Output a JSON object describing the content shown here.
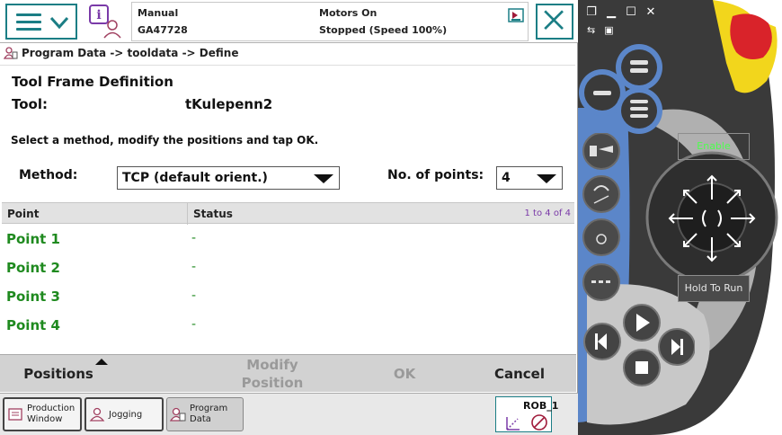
{
  "header": {
    "mode": "Manual",
    "controller": "GA47728",
    "motors": "Motors On",
    "state": "Stopped (Speed 100%)"
  },
  "breadcrumb": "Program Data -> tooldata -> Define",
  "form": {
    "title": "Tool Frame Definition",
    "tool_label": "Tool:",
    "tool_value": "tKulepenn2",
    "instruction": "Select a method, modify the positions and tap OK.",
    "method_label": "Method:",
    "method_value": "TCP (default orient.)",
    "points_label": "No. of points:",
    "points_value": "4"
  },
  "table": {
    "col_point": "Point",
    "col_status": "Status",
    "range": "1 to 4 of 4",
    "rows": [
      {
        "point": "Point  1",
        "status": "-"
      },
      {
        "point": "Point  2",
        "status": "-"
      },
      {
        "point": "Point  3",
        "status": "-"
      },
      {
        "point": "Point  4",
        "status": "-"
      }
    ]
  },
  "actions": {
    "positions": "Positions",
    "modify_line1": "Modify",
    "modify_line2": "Position",
    "ok": "OK",
    "cancel": "Cancel"
  },
  "taskbar": {
    "production_line1": "Production",
    "production_line2": "Window",
    "jogging": "Jogging",
    "program_line1": "Program",
    "program_line2": "Data",
    "rob": "ROB_1"
  },
  "device": {
    "enable": "Enable",
    "hold_to_run": "Hold To Run"
  },
  "colors": {
    "accent": "#1b7e85",
    "point_text": "#1f8a1f",
    "range_text": "#7a3aa8",
    "disabled": "#9a9a9a",
    "device_blue": "#5b86c9",
    "estop_red": "#d9232a",
    "estop_yellow": "#f2d61c"
  }
}
